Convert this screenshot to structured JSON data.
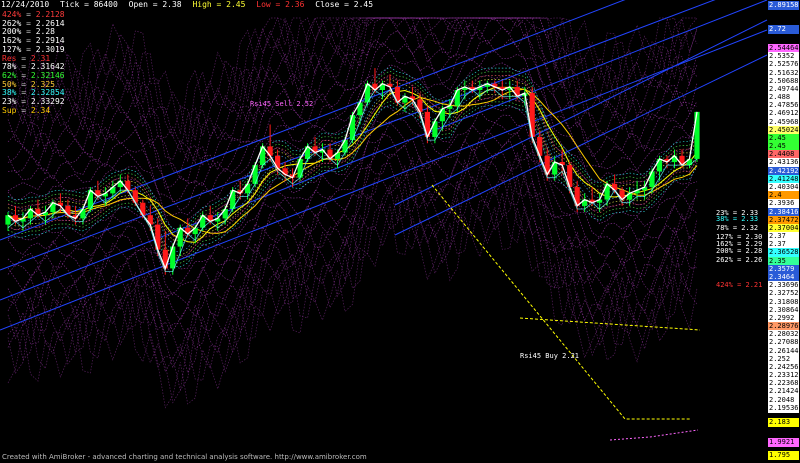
{
  "header": {
    "date": "12/24/2010",
    "tick": "Tick = 86400",
    "open": "Open = 2.38",
    "high": "High = 2.45",
    "low": "Low = 2.36",
    "close": "Close = 2.45"
  },
  "levels": [
    {
      "label": "424%",
      "value": "2.2128",
      "color": "#ff3b3b"
    },
    {
      "label": "262%",
      "value": "2.2614",
      "color": "#ffffff"
    },
    {
      "label": "200%",
      "value": "2.28",
      "color": "#ffffff"
    },
    {
      "label": "162%",
      "value": "2.2914",
      "color": "#ffffff"
    },
    {
      "label": "127%",
      "value": "2.3019",
      "color": "#ffffff"
    },
    {
      "label": "Res",
      "value": "2.31",
      "color": "#ff3030"
    },
    {
      "label": "78%",
      "value": "2.31642",
      "color": "#ffffff"
    },
    {
      "label": "62%",
      "value": "2.32146",
      "color": "#33ff33"
    },
    {
      "label": "50%",
      "value": "2.325",
      "color": "#ffcc33"
    },
    {
      "label": "38%",
      "value": "2.32854",
      "color": "#33ffff"
    },
    {
      "label": "23%",
      "value": "2.33292",
      "color": "#ffffff"
    },
    {
      "label": "Sup",
      "value": "2.34",
      "color": "#ffcc00"
    }
  ],
  "annotations": {
    "rsi_sell": "Rsi45 Sell 2.52",
    "rsi_buy": "Rsi45 Buy 2.21",
    "fib_right": [
      {
        "text": "23% = 2.33",
        "color": "#ffffff"
      },
      {
        "text": "38% = 2.33",
        "color": "#33ffff"
      },
      {
        "text": "78% = 2.32",
        "color": "#ffffff"
      },
      {
        "text": "127% = 2.30",
        "color": "#ffffff"
      },
      {
        "text": "162% = 2.29",
        "color": "#ffffff"
      },
      {
        "text": "200% = 2.28",
        "color": "#ffffff"
      },
      {
        "text": "262% = 2.26",
        "color": "#ffffff"
      },
      {
        "text": "424% = 2.21",
        "color": "#ff3333"
      }
    ]
  },
  "footer": "Created with AmiBroker - advanced charting and technical analysis software. http://www.amibroker.com",
  "colors": {
    "up": "#00ff2a",
    "down": "#ff1a1a",
    "close_line": "#ffffff",
    "ma": "#ffff00",
    "envelope": "#b040c0",
    "channel": "#2244ff"
  },
  "chart_data": {
    "type": "candlestick",
    "ylim": [
      1.795,
      2.89158
    ],
    "y_axis_labels": [
      {
        "v": "2.89158",
        "bg": "#2a5bd7",
        "fg": "#ffffff"
      },
      {
        "v": "2.72",
        "bg": "#2a5bd7",
        "fg": "#ffffff"
      },
      {
        "v": "2.54464",
        "bg": "#ff66ff",
        "fg": "#000000"
      },
      {
        "v": "2.5352",
        "bg": "#ffffff",
        "fg": "#000000"
      },
      {
        "v": "2.52576",
        "bg": "#ffffff",
        "fg": "#000000"
      },
      {
        "v": "2.51632",
        "bg": "#ffffff",
        "fg": "#000000"
      },
      {
        "v": "2.50688",
        "bg": "#ffffff",
        "fg": "#000000"
      },
      {
        "v": "2.49744",
        "bg": "#ffffff",
        "fg": "#000000"
      },
      {
        "v": "2.488",
        "bg": "#ffffff",
        "fg": "#000000"
      },
      {
        "v": "2.47856",
        "bg": "#ffffff",
        "fg": "#000000"
      },
      {
        "v": "2.46912",
        "bg": "#ffffff",
        "fg": "#000000"
      },
      {
        "v": "2.45968",
        "bg": "#ffffff",
        "fg": "#000000"
      },
      {
        "v": "2.45024",
        "bg": "#ffff66",
        "fg": "#000000"
      },
      {
        "v": "2.45",
        "bg": "#33ff33",
        "fg": "#000000"
      },
      {
        "v": "2.45",
        "bg": "#33ff33",
        "fg": "#000000"
      },
      {
        "v": "2.4408",
        "bg": "#ff6666",
        "fg": "#000000"
      },
      {
        "v": "2.43136",
        "bg": "#ffffff",
        "fg": "#000000"
      },
      {
        "v": "2.42192",
        "bg": "#2a5bd7",
        "fg": "#ffffff"
      },
      {
        "v": "2.41248",
        "bg": "#33ffff",
        "fg": "#000000"
      },
      {
        "v": "2.40304",
        "bg": "#ffffff",
        "fg": "#000000"
      },
      {
        "v": "2.4",
        "bg": "#ff9900",
        "fg": "#000000"
      },
      {
        "v": "2.3936",
        "bg": "#ffffff",
        "fg": "#000000"
      },
      {
        "v": "2.38416",
        "bg": "#2a5bd7",
        "fg": "#ffffff"
      },
      {
        "v": "2.37472",
        "bg": "#ff9900",
        "fg": "#000000"
      },
      {
        "v": "2.37004",
        "bg": "#ffff33",
        "fg": "#000000"
      },
      {
        "v": "2.37",
        "bg": "#ffffff",
        "fg": "#000000"
      },
      {
        "v": "2.37",
        "bg": "#ffffff",
        "fg": "#000000"
      },
      {
        "v": "2.36528",
        "bg": "#33ffff",
        "fg": "#000000"
      },
      {
        "v": "2.35",
        "bg": "#33ff99",
        "fg": "#000000"
      },
      {
        "v": "2.3579",
        "bg": "#2a5bd7",
        "fg": "#ffffff"
      },
      {
        "v": "2.3464",
        "bg": "#2a5bd7",
        "fg": "#ffffff"
      },
      {
        "v": "2.33696",
        "bg": "#ffffff",
        "fg": "#000000"
      },
      {
        "v": "2.32752",
        "bg": "#ffffff",
        "fg": "#000000"
      },
      {
        "v": "2.31808",
        "bg": "#ffffff",
        "fg": "#000000"
      },
      {
        "v": "2.30864",
        "bg": "#ffffff",
        "fg": "#000000"
      },
      {
        "v": "2.2992",
        "bg": "#ffffff",
        "fg": "#000000"
      },
      {
        "v": "2.28976",
        "bg": "#ff9966",
        "fg": "#000000"
      },
      {
        "v": "2.28032",
        "bg": "#ffffff",
        "fg": "#000000"
      },
      {
        "v": "2.27088",
        "bg": "#ffffff",
        "fg": "#000000"
      },
      {
        "v": "2.26144",
        "bg": "#ffffff",
        "fg": "#000000"
      },
      {
        "v": "2.252",
        "bg": "#ffffff",
        "fg": "#000000"
      },
      {
        "v": "2.24256",
        "bg": "#ffffff",
        "fg": "#000000"
      },
      {
        "v": "2.23312",
        "bg": "#ffffff",
        "fg": "#000000"
      },
      {
        "v": "2.22368",
        "bg": "#ffffff",
        "fg": "#000000"
      },
      {
        "v": "2.21424",
        "bg": "#ffffff",
        "fg": "#000000"
      },
      {
        "v": "2.2048",
        "bg": "#ffffff",
        "fg": "#000000"
      },
      {
        "v": "2.19536",
        "bg": "#ffffff",
        "fg": "#000000"
      },
      {
        "v": "2.183",
        "bg": "#ffff00",
        "fg": "#000000"
      },
      {
        "v": "1.9921",
        "bg": "#ff66ff",
        "fg": "#000000"
      },
      {
        "v": "1.795",
        "bg": "#ffff00",
        "fg": "#000000"
      }
    ],
    "candles": [
      [
        2.27,
        2.29,
        2.26,
        2.285
      ],
      [
        2.285,
        2.3,
        2.27,
        2.275
      ],
      [
        2.275,
        2.29,
        2.26,
        2.28
      ],
      [
        2.28,
        2.3,
        2.27,
        2.295
      ],
      [
        2.295,
        2.31,
        2.28,
        2.285
      ],
      [
        2.285,
        2.3,
        2.27,
        2.29
      ],
      [
        2.29,
        2.31,
        2.28,
        2.305
      ],
      [
        2.305,
        2.32,
        2.29,
        2.3
      ],
      [
        2.3,
        2.31,
        2.28,
        2.285
      ],
      [
        2.285,
        2.3,
        2.27,
        2.28
      ],
      [
        2.28,
        2.3,
        2.27,
        2.295
      ],
      [
        2.295,
        2.33,
        2.29,
        2.325
      ],
      [
        2.325,
        2.34,
        2.31,
        2.315
      ],
      [
        2.315,
        2.33,
        2.3,
        2.32
      ],
      [
        2.32,
        2.34,
        2.31,
        2.33
      ],
      [
        2.33,
        2.35,
        2.32,
        2.34
      ],
      [
        2.34,
        2.35,
        2.32,
        2.325
      ],
      [
        2.325,
        2.33,
        2.3,
        2.305
      ],
      [
        2.305,
        2.31,
        2.28,
        2.285
      ],
      [
        2.285,
        2.3,
        2.26,
        2.27
      ],
      [
        2.27,
        2.28,
        2.22,
        2.23
      ],
      [
        2.23,
        2.26,
        2.19,
        2.2
      ],
      [
        2.2,
        2.24,
        2.19,
        2.235
      ],
      [
        2.235,
        2.27,
        2.22,
        2.265
      ],
      [
        2.265,
        2.28,
        2.25,
        2.255
      ],
      [
        2.255,
        2.27,
        2.24,
        2.265
      ],
      [
        2.265,
        2.29,
        2.26,
        2.285
      ],
      [
        2.285,
        2.3,
        2.27,
        2.275
      ],
      [
        2.275,
        2.29,
        2.26,
        2.28
      ],
      [
        2.28,
        2.3,
        2.27,
        2.295
      ],
      [
        2.295,
        2.33,
        2.29,
        2.325
      ],
      [
        2.325,
        2.34,
        2.31,
        2.32
      ],
      [
        2.32,
        2.34,
        2.31,
        2.335
      ],
      [
        2.335,
        2.37,
        2.33,
        2.365
      ],
      [
        2.365,
        2.4,
        2.36,
        2.395
      ],
      [
        2.395,
        2.43,
        2.37,
        2.38
      ],
      [
        2.38,
        2.39,
        2.35,
        2.36
      ],
      [
        2.36,
        2.37,
        2.34,
        2.35
      ],
      [
        2.35,
        2.36,
        2.33,
        2.345
      ],
      [
        2.345,
        2.38,
        2.34,
        2.375
      ],
      [
        2.375,
        2.4,
        2.37,
        2.395
      ],
      [
        2.395,
        2.41,
        2.38,
        2.385
      ],
      [
        2.385,
        2.4,
        2.37,
        2.39
      ],
      [
        2.39,
        2.4,
        2.37,
        2.375
      ],
      [
        2.375,
        2.39,
        2.36,
        2.385
      ],
      [
        2.385,
        2.41,
        2.38,
        2.405
      ],
      [
        2.405,
        2.45,
        2.4,
        2.445
      ],
      [
        2.445,
        2.47,
        2.43,
        2.465
      ],
      [
        2.465,
        2.5,
        2.46,
        2.495
      ],
      [
        2.495,
        2.52,
        2.48,
        2.485
      ],
      [
        2.485,
        2.5,
        2.47,
        2.495
      ],
      [
        2.495,
        2.51,
        2.48,
        2.49
      ],
      [
        2.49,
        2.5,
        2.46,
        2.465
      ],
      [
        2.465,
        2.48,
        2.45,
        2.475
      ],
      [
        2.475,
        2.49,
        2.46,
        2.47
      ],
      [
        2.47,
        2.48,
        2.44,
        2.45
      ],
      [
        2.45,
        2.46,
        2.4,
        2.41
      ],
      [
        2.41,
        2.44,
        2.4,
        2.435
      ],
      [
        2.435,
        2.46,
        2.42,
        2.455
      ],
      [
        2.455,
        2.47,
        2.44,
        2.46
      ],
      [
        2.46,
        2.49,
        2.45,
        2.485
      ],
      [
        2.485,
        2.5,
        2.47,
        2.49
      ],
      [
        2.49,
        2.5,
        2.48,
        2.485
      ],
      [
        2.485,
        2.5,
        2.47,
        2.49
      ],
      [
        2.49,
        2.5,
        2.48,
        2.495
      ],
      [
        2.495,
        2.5,
        2.48,
        2.49
      ],
      [
        2.49,
        2.5,
        2.47,
        2.485
      ],
      [
        2.485,
        2.5,
        2.47,
        2.49
      ],
      [
        2.49,
        2.5,
        2.47,
        2.475
      ],
      [
        2.475,
        2.49,
        2.46,
        2.48
      ],
      [
        2.48,
        2.49,
        2.4,
        2.41
      ],
      [
        2.41,
        2.42,
        2.37,
        2.38
      ],
      [
        2.38,
        2.39,
        2.34,
        2.35
      ],
      [
        2.35,
        2.38,
        2.34,
        2.37
      ],
      [
        2.37,
        2.39,
        2.35,
        2.365
      ],
      [
        2.365,
        2.37,
        2.32,
        2.33
      ],
      [
        2.33,
        2.34,
        2.29,
        2.3
      ],
      [
        2.3,
        2.32,
        2.29,
        2.31
      ],
      [
        2.31,
        2.33,
        2.3,
        2.305
      ],
      [
        2.305,
        2.32,
        2.29,
        2.31
      ],
      [
        2.31,
        2.34,
        2.3,
        2.335
      ],
      [
        2.335,
        2.35,
        2.32,
        2.325
      ],
      [
        2.325,
        2.33,
        2.3,
        2.31
      ],
      [
        2.31,
        2.33,
        2.3,
        2.32
      ],
      [
        2.32,
        2.34,
        2.31,
        2.325
      ],
      [
        2.325,
        2.34,
        2.31,
        2.33
      ],
      [
        2.33,
        2.36,
        2.32,
        2.355
      ],
      [
        2.355,
        2.38,
        2.34,
        2.375
      ],
      [
        2.375,
        2.38,
        2.36,
        2.37
      ],
      [
        2.37,
        2.39,
        2.36,
        2.38
      ],
      [
        2.38,
        2.39,
        2.36,
        2.365
      ],
      [
        2.365,
        2.38,
        2.36,
        2.375
      ],
      [
        2.375,
        2.45,
        2.37,
        2.45
      ]
    ]
  }
}
